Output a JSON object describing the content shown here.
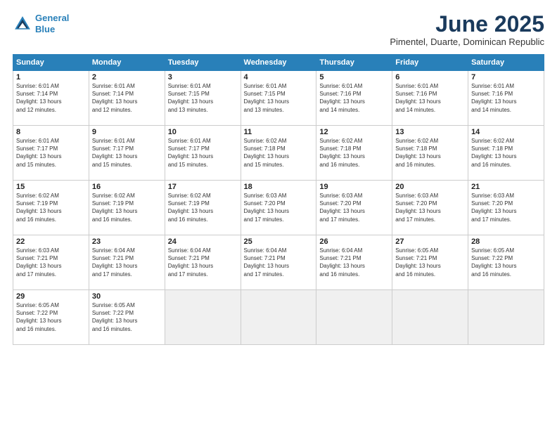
{
  "header": {
    "logo_line1": "General",
    "logo_line2": "Blue",
    "month_title": "June 2025",
    "subtitle": "Pimentel, Duarte, Dominican Republic"
  },
  "days_header": [
    "Sunday",
    "Monday",
    "Tuesday",
    "Wednesday",
    "Thursday",
    "Friday",
    "Saturday"
  ],
  "weeks": [
    [
      {
        "num": "1",
        "info": "Sunrise: 6:01 AM\nSunset: 7:14 PM\nDaylight: 13 hours\nand 12 minutes."
      },
      {
        "num": "2",
        "info": "Sunrise: 6:01 AM\nSunset: 7:14 PM\nDaylight: 13 hours\nand 12 minutes."
      },
      {
        "num": "3",
        "info": "Sunrise: 6:01 AM\nSunset: 7:15 PM\nDaylight: 13 hours\nand 13 minutes."
      },
      {
        "num": "4",
        "info": "Sunrise: 6:01 AM\nSunset: 7:15 PM\nDaylight: 13 hours\nand 13 minutes."
      },
      {
        "num": "5",
        "info": "Sunrise: 6:01 AM\nSunset: 7:16 PM\nDaylight: 13 hours\nand 14 minutes."
      },
      {
        "num": "6",
        "info": "Sunrise: 6:01 AM\nSunset: 7:16 PM\nDaylight: 13 hours\nand 14 minutes."
      },
      {
        "num": "7",
        "info": "Sunrise: 6:01 AM\nSunset: 7:16 PM\nDaylight: 13 hours\nand 14 minutes."
      }
    ],
    [
      {
        "num": "8",
        "info": "Sunrise: 6:01 AM\nSunset: 7:17 PM\nDaylight: 13 hours\nand 15 minutes."
      },
      {
        "num": "9",
        "info": "Sunrise: 6:01 AM\nSunset: 7:17 PM\nDaylight: 13 hours\nand 15 minutes."
      },
      {
        "num": "10",
        "info": "Sunrise: 6:01 AM\nSunset: 7:17 PM\nDaylight: 13 hours\nand 15 minutes."
      },
      {
        "num": "11",
        "info": "Sunrise: 6:02 AM\nSunset: 7:18 PM\nDaylight: 13 hours\nand 15 minutes."
      },
      {
        "num": "12",
        "info": "Sunrise: 6:02 AM\nSunset: 7:18 PM\nDaylight: 13 hours\nand 16 minutes."
      },
      {
        "num": "13",
        "info": "Sunrise: 6:02 AM\nSunset: 7:18 PM\nDaylight: 13 hours\nand 16 minutes."
      },
      {
        "num": "14",
        "info": "Sunrise: 6:02 AM\nSunset: 7:18 PM\nDaylight: 13 hours\nand 16 minutes."
      }
    ],
    [
      {
        "num": "15",
        "info": "Sunrise: 6:02 AM\nSunset: 7:19 PM\nDaylight: 13 hours\nand 16 minutes."
      },
      {
        "num": "16",
        "info": "Sunrise: 6:02 AM\nSunset: 7:19 PM\nDaylight: 13 hours\nand 16 minutes."
      },
      {
        "num": "17",
        "info": "Sunrise: 6:02 AM\nSunset: 7:19 PM\nDaylight: 13 hours\nand 16 minutes."
      },
      {
        "num": "18",
        "info": "Sunrise: 6:03 AM\nSunset: 7:20 PM\nDaylight: 13 hours\nand 17 minutes."
      },
      {
        "num": "19",
        "info": "Sunrise: 6:03 AM\nSunset: 7:20 PM\nDaylight: 13 hours\nand 17 minutes."
      },
      {
        "num": "20",
        "info": "Sunrise: 6:03 AM\nSunset: 7:20 PM\nDaylight: 13 hours\nand 17 minutes."
      },
      {
        "num": "21",
        "info": "Sunrise: 6:03 AM\nSunset: 7:20 PM\nDaylight: 13 hours\nand 17 minutes."
      }
    ],
    [
      {
        "num": "22",
        "info": "Sunrise: 6:03 AM\nSunset: 7:21 PM\nDaylight: 13 hours\nand 17 minutes."
      },
      {
        "num": "23",
        "info": "Sunrise: 6:04 AM\nSunset: 7:21 PM\nDaylight: 13 hours\nand 17 minutes."
      },
      {
        "num": "24",
        "info": "Sunrise: 6:04 AM\nSunset: 7:21 PM\nDaylight: 13 hours\nand 17 minutes."
      },
      {
        "num": "25",
        "info": "Sunrise: 6:04 AM\nSunset: 7:21 PM\nDaylight: 13 hours\nand 17 minutes."
      },
      {
        "num": "26",
        "info": "Sunrise: 6:04 AM\nSunset: 7:21 PM\nDaylight: 13 hours\nand 16 minutes."
      },
      {
        "num": "27",
        "info": "Sunrise: 6:05 AM\nSunset: 7:21 PM\nDaylight: 13 hours\nand 16 minutes."
      },
      {
        "num": "28",
        "info": "Sunrise: 6:05 AM\nSunset: 7:22 PM\nDaylight: 13 hours\nand 16 minutes."
      }
    ],
    [
      {
        "num": "29",
        "info": "Sunrise: 6:05 AM\nSunset: 7:22 PM\nDaylight: 13 hours\nand 16 minutes."
      },
      {
        "num": "30",
        "info": "Sunrise: 6:05 AM\nSunset: 7:22 PM\nDaylight: 13 hours\nand 16 minutes."
      },
      {
        "num": "",
        "info": ""
      },
      {
        "num": "",
        "info": ""
      },
      {
        "num": "",
        "info": ""
      },
      {
        "num": "",
        "info": ""
      },
      {
        "num": "",
        "info": ""
      }
    ]
  ]
}
